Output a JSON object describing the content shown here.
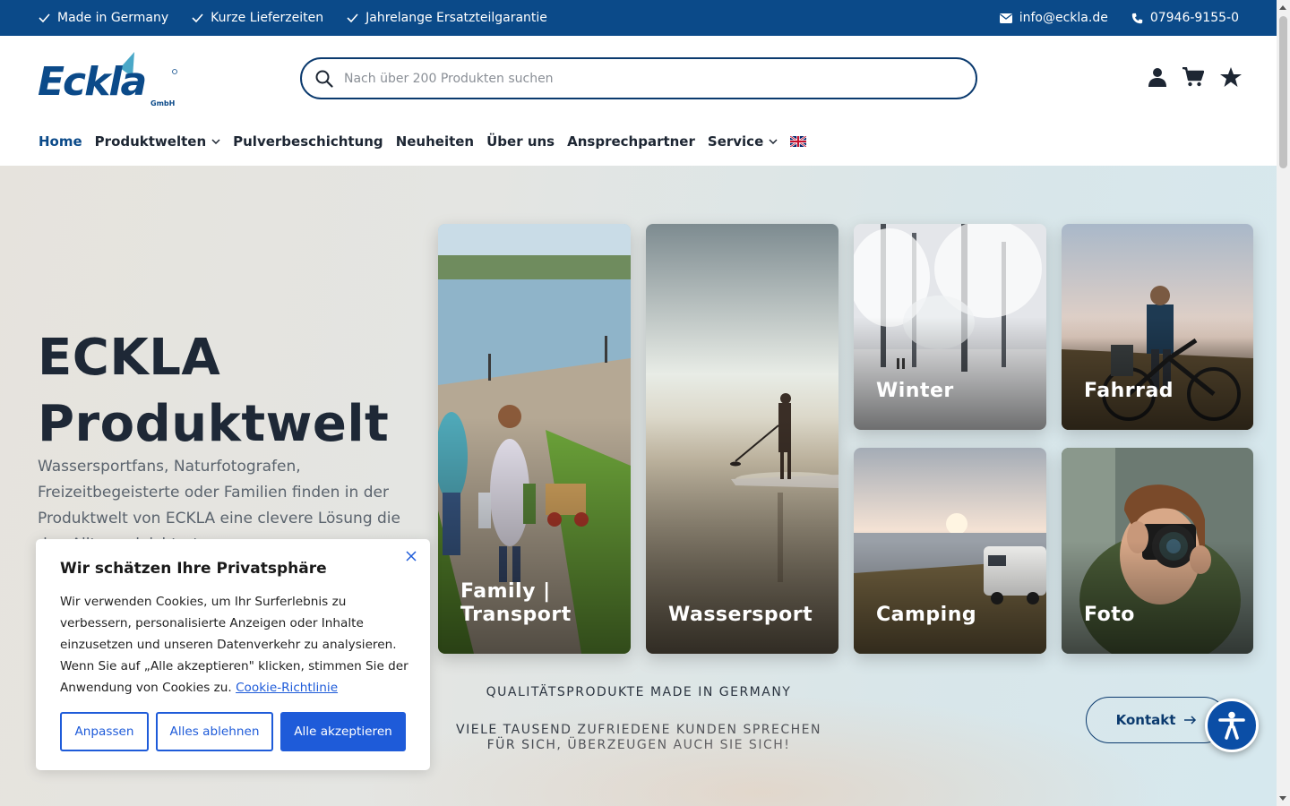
{
  "topbar": {
    "usps": [
      "Made in Germany",
      "Kurze Lieferzeiten",
      "Jahrelange Ersatzteilgarantie"
    ],
    "email": "info@eckla.de",
    "phone": "07946-9155-0"
  },
  "header": {
    "logo_text": "Eckla",
    "logo_sub": "GmbH",
    "search_placeholder": "Nach über 200 Produkten suchen",
    "icons": [
      "user-icon",
      "cart-icon",
      "star-icon"
    ]
  },
  "nav": {
    "items": [
      {
        "label": "Home"
      },
      {
        "label": "Produktwelten"
      },
      {
        "label": "Pulverbeschichtung"
      },
      {
        "label": "Neuheiten"
      },
      {
        "label": "Über uns"
      },
      {
        "label": "Ansprechpartner"
      },
      {
        "label": "Service"
      }
    ]
  },
  "hero": {
    "title_line1": "ECKLA",
    "title_line2": "Produktwelt",
    "text": "Wassersportfans, Naturfotografen, Freizeitbegeisterte oder Familien finden in der Produktwelt von ECKLA eine clevere Lösung die den Alltag erleichtert.",
    "tiles": [
      {
        "label": "Family |\nTransport"
      },
      {
        "label": "Wassersport"
      },
      {
        "label": "Winter"
      },
      {
        "label": "Fahrrad"
      },
      {
        "label": "Camping"
      },
      {
        "label": "Foto"
      }
    ],
    "tagline1": "QUALITÄTSPRODUKTE MADE IN GERMANY",
    "tagline2": "VIELE TAUSEND ZUFRIEDENE KUNDEN SPRECHEN FÜR SICH, ÜBERZEUGEN AUCH SIE SICH!",
    "kontakt_label": "Kontakt"
  },
  "cookie": {
    "title": "Wir schätzen Ihre Privatsphäre",
    "body": "Wir verwenden Cookies, um Ihr Surferlebnis zu verbessern, personalisierte Anzeigen oder Inhalte einzusetzen und unseren Datenverkehr zu analysieren. Wenn Sie auf „Alle akzeptieren\" klicken, stimmen Sie der Anwendung von Cookies zu.",
    "link": "Cookie-Richtlinie",
    "buttons": {
      "customize": "Anpassen",
      "reject": "Alles ablehnen",
      "accept": "Alle akzeptieren"
    },
    "accent_color": "#1e5bd9"
  },
  "colors": {
    "brand": "#0b4a89",
    "text": "#1d2633"
  }
}
